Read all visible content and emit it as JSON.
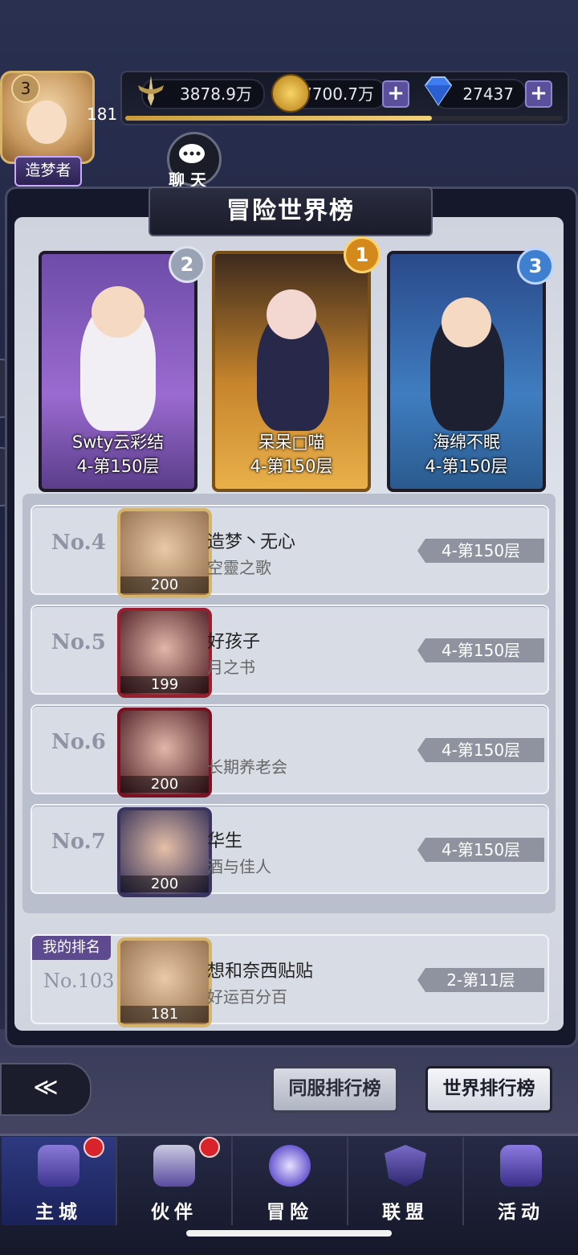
{
  "header": {
    "power": "3878.9万",
    "gold": "7700.7万",
    "gems": "27437",
    "exp_progress": 0.7,
    "player_level": "181",
    "vip_level": "3",
    "title_badge": "造梦者",
    "chat_label": "聊 天",
    "plus_label": "+"
  },
  "panel": {
    "title": "冒险世界榜"
  },
  "podium": [
    {
      "place": "2",
      "name": "Swty云彩结",
      "floor": "4-第150层"
    },
    {
      "place": "1",
      "name": "呆呆□喵",
      "floor": "4-第150层"
    },
    {
      "place": "3",
      "name": "海绵不眠",
      "floor": "4-第150层"
    }
  ],
  "rankings": [
    {
      "rank": "No.4",
      "level": "200",
      "name": "造梦丶无心",
      "guild": "空靈之歌",
      "floor": "4-第150层"
    },
    {
      "rank": "No.5",
      "level": "199",
      "name": "好孩子",
      "guild": "月之书",
      "floor": "4-第150层"
    },
    {
      "rank": "No.6",
      "level": "200",
      "name": "",
      "guild": "长期养老会",
      "floor": "4-第150层"
    },
    {
      "rank": "No.7",
      "level": "200",
      "name": "华生",
      "guild": "酒与佳人",
      "floor": "4-第150层"
    }
  ],
  "my_rank": {
    "tag": "我的排名",
    "rank": "No.103",
    "level": "181",
    "name": "想和奈西贴贴",
    "guild": "好运百分百",
    "floor": "2-第11层"
  },
  "buttons": {
    "back": "≪",
    "server_rank": "同服排行榜",
    "world_rank": "世界排行榜"
  },
  "nav": [
    {
      "label": "主城",
      "badge": true
    },
    {
      "label": "伙伴",
      "badge": true
    },
    {
      "label": "冒险",
      "badge": false
    },
    {
      "label": "联盟",
      "badge": false
    },
    {
      "label": "活动",
      "badge": false
    }
  ],
  "colors": {
    "accent": "#5e4a8e",
    "gold": "#d6b36a",
    "badge_red": "#d8232a"
  }
}
